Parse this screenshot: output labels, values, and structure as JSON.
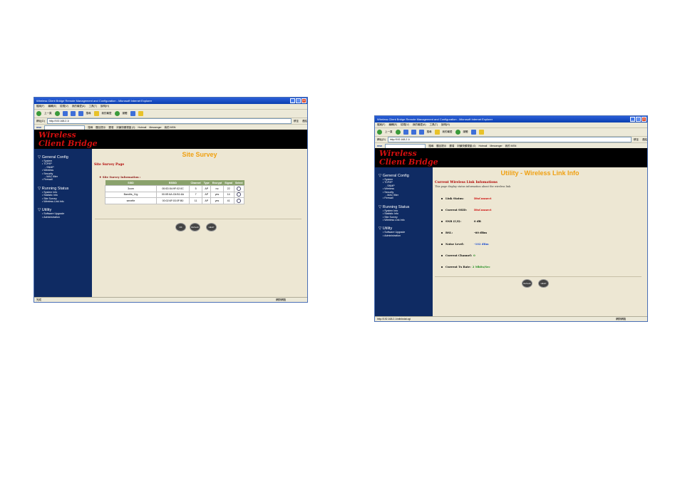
{
  "browser": {
    "title": "Wireless Client Bridge Remote Management and Configuration - Microsoft Internet Explorer",
    "menu": [
      "檔案(F)",
      "編輯(E)",
      "檢視(V)",
      "我的最愛(A)",
      "工具(T)",
      "說明(H)"
    ],
    "toolbar": {
      "back": "上一頁",
      "search": "搜尋",
      "favorites": "我的最愛",
      "media": "媒體"
    },
    "address_label": "網址(D)",
    "address": "http://192.168.2.1/",
    "go_label": "移至",
    "links_label": "連結",
    "linkbar": [
      "搜尋",
      "醒目提示",
      "選項",
      "封鎖快顯視窗 (0)",
      "Hotmail",
      "Messenger",
      "我的 MSN"
    ]
  },
  "app": {
    "logo_line1": "Wireless",
    "logo_line2": "Client Bridge"
  },
  "sidebar": {
    "general_config": "General Config",
    "general_items": [
      "System",
      "TCP/IP",
      "Wireless",
      "Security",
      "Firewall"
    ],
    "snmp": "SNMP",
    "mac_filter": "MAC filter",
    "running_status": "Running Status",
    "running_items": [
      "System Info",
      "Statistic Info",
      "Site Survey",
      "Wireless Link Info"
    ],
    "utility": "Utility",
    "utility_items": [
      "Software Upgrade",
      "Administration"
    ]
  },
  "survey_page": {
    "title": "Site Survey",
    "heading": "Site Survey Page",
    "info_label": "Site Survey Information :",
    "columns": [
      "SSID",
      "BSSID",
      "Channel",
      "Type",
      "Encrypt",
      "Signal",
      "Select"
    ],
    "rows": [
      [
        "3com",
        "00:0D:54:9F:02:0C",
        "5",
        "AP",
        "no",
        "22"
      ],
      [
        "Bandits_11g",
        "00:0E:6A:C6:B1:6A",
        "7",
        "AP",
        "yes",
        "14"
      ],
      [
        "senefte",
        "00:02:6F:03:0F:B0",
        "11",
        "AP",
        "yes",
        "41"
      ]
    ],
    "buttons": [
      "OK",
      "Refresh",
      "HELP"
    ],
    "status": "完成",
    "zone": "網際網路"
  },
  "link_page": {
    "title": "Utility - Wireless Link Info",
    "heading": "Current Wireless Link Infomations",
    "description": "This page display status information about the wireless link",
    "fields": [
      {
        "label": "Link Status:",
        "value": "DisConnect",
        "color": "#cc0000"
      },
      {
        "label": "Current SSID:",
        "value": "DisConnect",
        "color": "#cc0000"
      },
      {
        "label": "SNR (C/I):",
        "value": "0 dB",
        "color": "#000000"
      },
      {
        "label": "RSL:",
        "value": "-60 dBm",
        "color": "#000000"
      },
      {
        "label": "Noise Level:",
        "value": "-102 dBm",
        "color": "#1f4fd0"
      },
      {
        "label": "Current Channel:",
        "value": "0",
        "color": "#1a8a1a"
      },
      {
        "label": "Current Tx Rate:",
        "value": "2 Mbits/Sec",
        "color": "#1a8a1a"
      }
    ],
    "buttons": [
      "Refresh",
      "HELP"
    ],
    "status": "http://192.168.2.1/wlinkstat.cgi",
    "zone": "網際網路"
  }
}
